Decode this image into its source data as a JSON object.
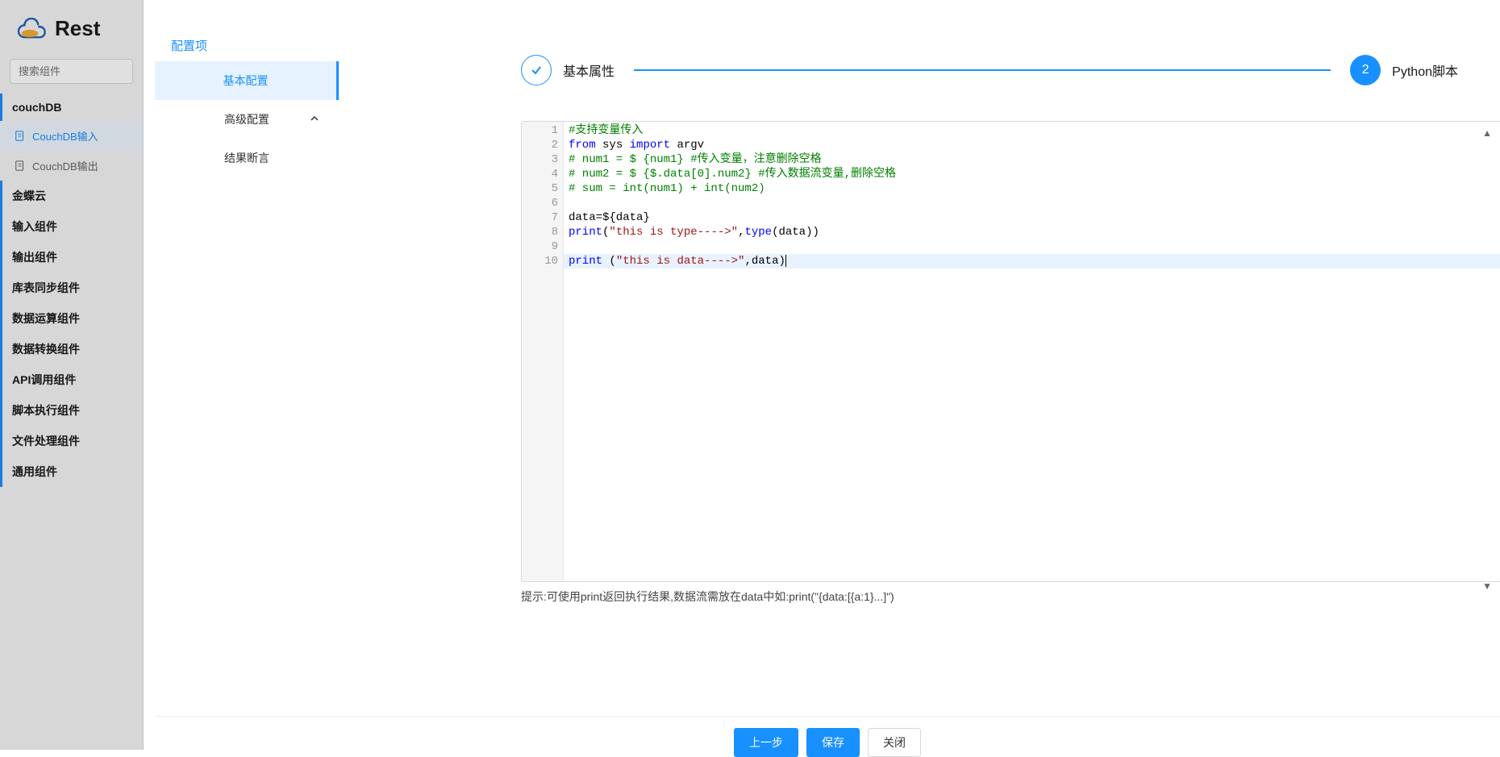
{
  "brand": "Rest",
  "search_placeholder": "搜索组件",
  "sidebar": {
    "groups": [
      {
        "label": "couchDB",
        "items": [
          {
            "label": "CouchDB输入",
            "active": true
          },
          {
            "label": "CouchDB输出",
            "active": false
          }
        ]
      },
      {
        "label": "金蝶云"
      },
      {
        "label": "输入组件"
      },
      {
        "label": "输出组件"
      },
      {
        "label": "库表同步组件"
      },
      {
        "label": "数据运算组件"
      },
      {
        "label": "数据转换组件"
      },
      {
        "label": "API调用组件"
      },
      {
        "label": "脚本执行组件"
      },
      {
        "label": "文件处理组件"
      },
      {
        "label": "通用组件"
      }
    ]
  },
  "modal": {
    "title": "配置项",
    "tabs": [
      {
        "label": "基本配置",
        "active": true
      },
      {
        "label": "高级配置",
        "expandable": true
      },
      {
        "label": "结果断言"
      }
    ],
    "steps": [
      {
        "num": "✓",
        "label": "基本属性",
        "state": "done"
      },
      {
        "num": "2",
        "label": "Python脚本",
        "state": "current"
      }
    ],
    "hint": "提示:可使用print返回执行结果,数据流需放在data中如:print(\"{data:[{a:1}...]\")",
    "footer": {
      "prev": "上一步",
      "save": "保存",
      "close": "关闭"
    }
  },
  "code": {
    "lines": [
      {
        "raw": "#支持变量传入",
        "cls": "comment"
      },
      {
        "raw": "from sys import argv",
        "cls": "import"
      },
      {
        "raw": "# num1 = $ {num1} #传入变量，注意删除空格",
        "cls": "comment"
      },
      {
        "raw": "# num2 = $ {$.data[0].num2} #传入数据流变量,删除空格",
        "cls": "comment"
      },
      {
        "raw": "# sum = int(num1) + int(num2)",
        "cls": "comment"
      },
      {
        "raw": "",
        "cls": "blank"
      },
      {
        "raw": "data=${data}",
        "cls": "plain"
      },
      {
        "raw": "print(\"this is type---->\",type(data))",
        "cls": "print1"
      },
      {
        "raw": "",
        "cls": "blank"
      },
      {
        "raw": "print (\"this is data---->\",data)",
        "cls": "print2",
        "hl": true
      }
    ]
  }
}
